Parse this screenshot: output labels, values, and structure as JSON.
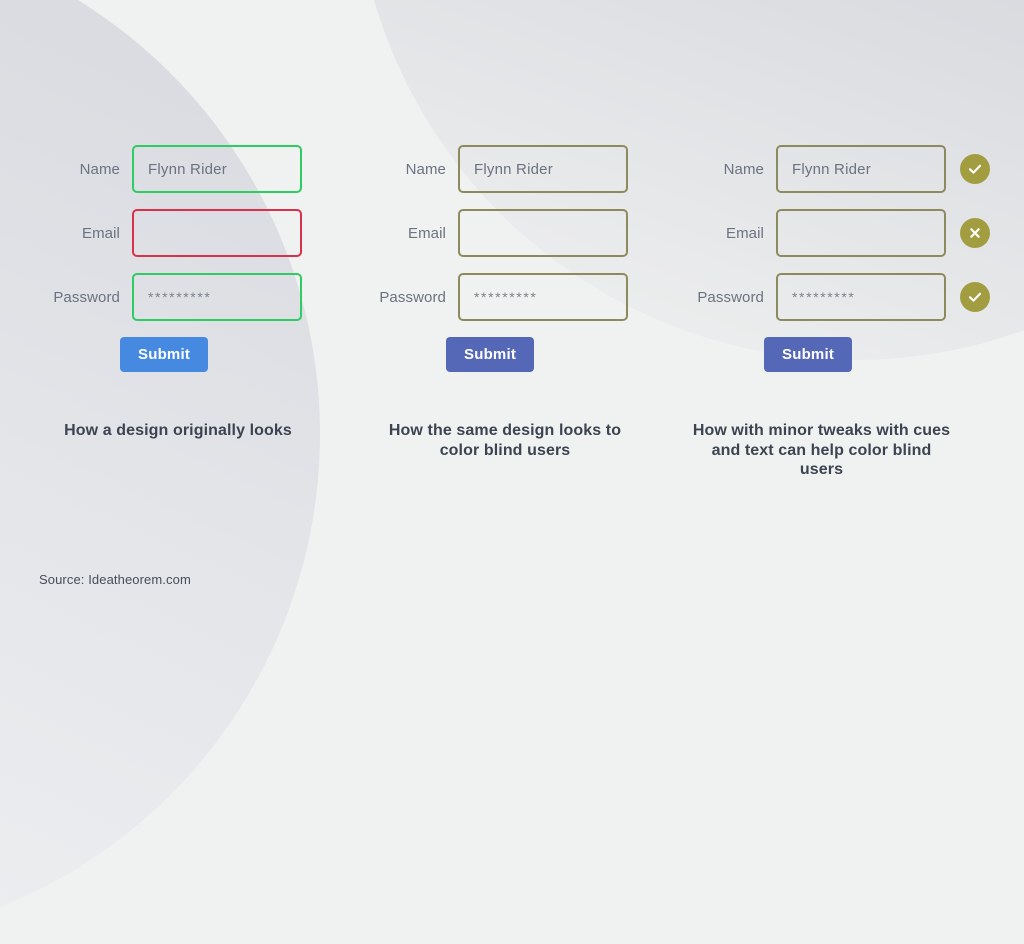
{
  "background_color": "#f0f2f1",
  "colors": {
    "valid_green": "#2ecc63",
    "error_red": "#d9304c",
    "colorblind_olive": "#8d8b5e",
    "badge_olive": "#a39d42",
    "submit_bright_blue": "#4589e0",
    "submit_muted_blue": "#5568b8",
    "label_gray": "#6b7280",
    "caption_dark": "#3d4451"
  },
  "columns": [
    {
      "id": "original",
      "caption": "How a design originally looks",
      "submit_label": "Submit",
      "submit_style": "bright",
      "fields": [
        {
          "label": "Name",
          "value": "Flynn Rider",
          "masked": false,
          "border": "green",
          "badge": "none"
        },
        {
          "label": "Email",
          "value": "",
          "masked": false,
          "border": "red",
          "badge": "none"
        },
        {
          "label": "Password",
          "value": "*********",
          "masked": true,
          "border": "green",
          "badge": "none"
        }
      ]
    },
    {
      "id": "colorblind",
      "caption": "How the same design looks to color blind users",
      "submit_label": "Submit",
      "submit_style": "muted",
      "fields": [
        {
          "label": "Name",
          "value": "Flynn Rider",
          "masked": false,
          "border": "olive",
          "badge": "none"
        },
        {
          "label": "Email",
          "value": "",
          "masked": false,
          "border": "olive",
          "badge": "none"
        },
        {
          "label": "Password",
          "value": "*********",
          "masked": true,
          "border": "olive",
          "badge": "none"
        }
      ]
    },
    {
      "id": "accessible",
      "caption": "How with minor tweaks with cues and text can help color blind users",
      "submit_label": "Submit",
      "submit_style": "muted",
      "fields": [
        {
          "label": "Name",
          "value": "Flynn Rider",
          "masked": false,
          "border": "olive",
          "badge": "check"
        },
        {
          "label": "Email",
          "value": "",
          "masked": false,
          "border": "olive",
          "badge": "cross"
        },
        {
          "label": "Password",
          "value": "*********",
          "masked": true,
          "border": "olive",
          "badge": "check"
        }
      ]
    }
  ],
  "source": "Source: Ideatheorem.com"
}
